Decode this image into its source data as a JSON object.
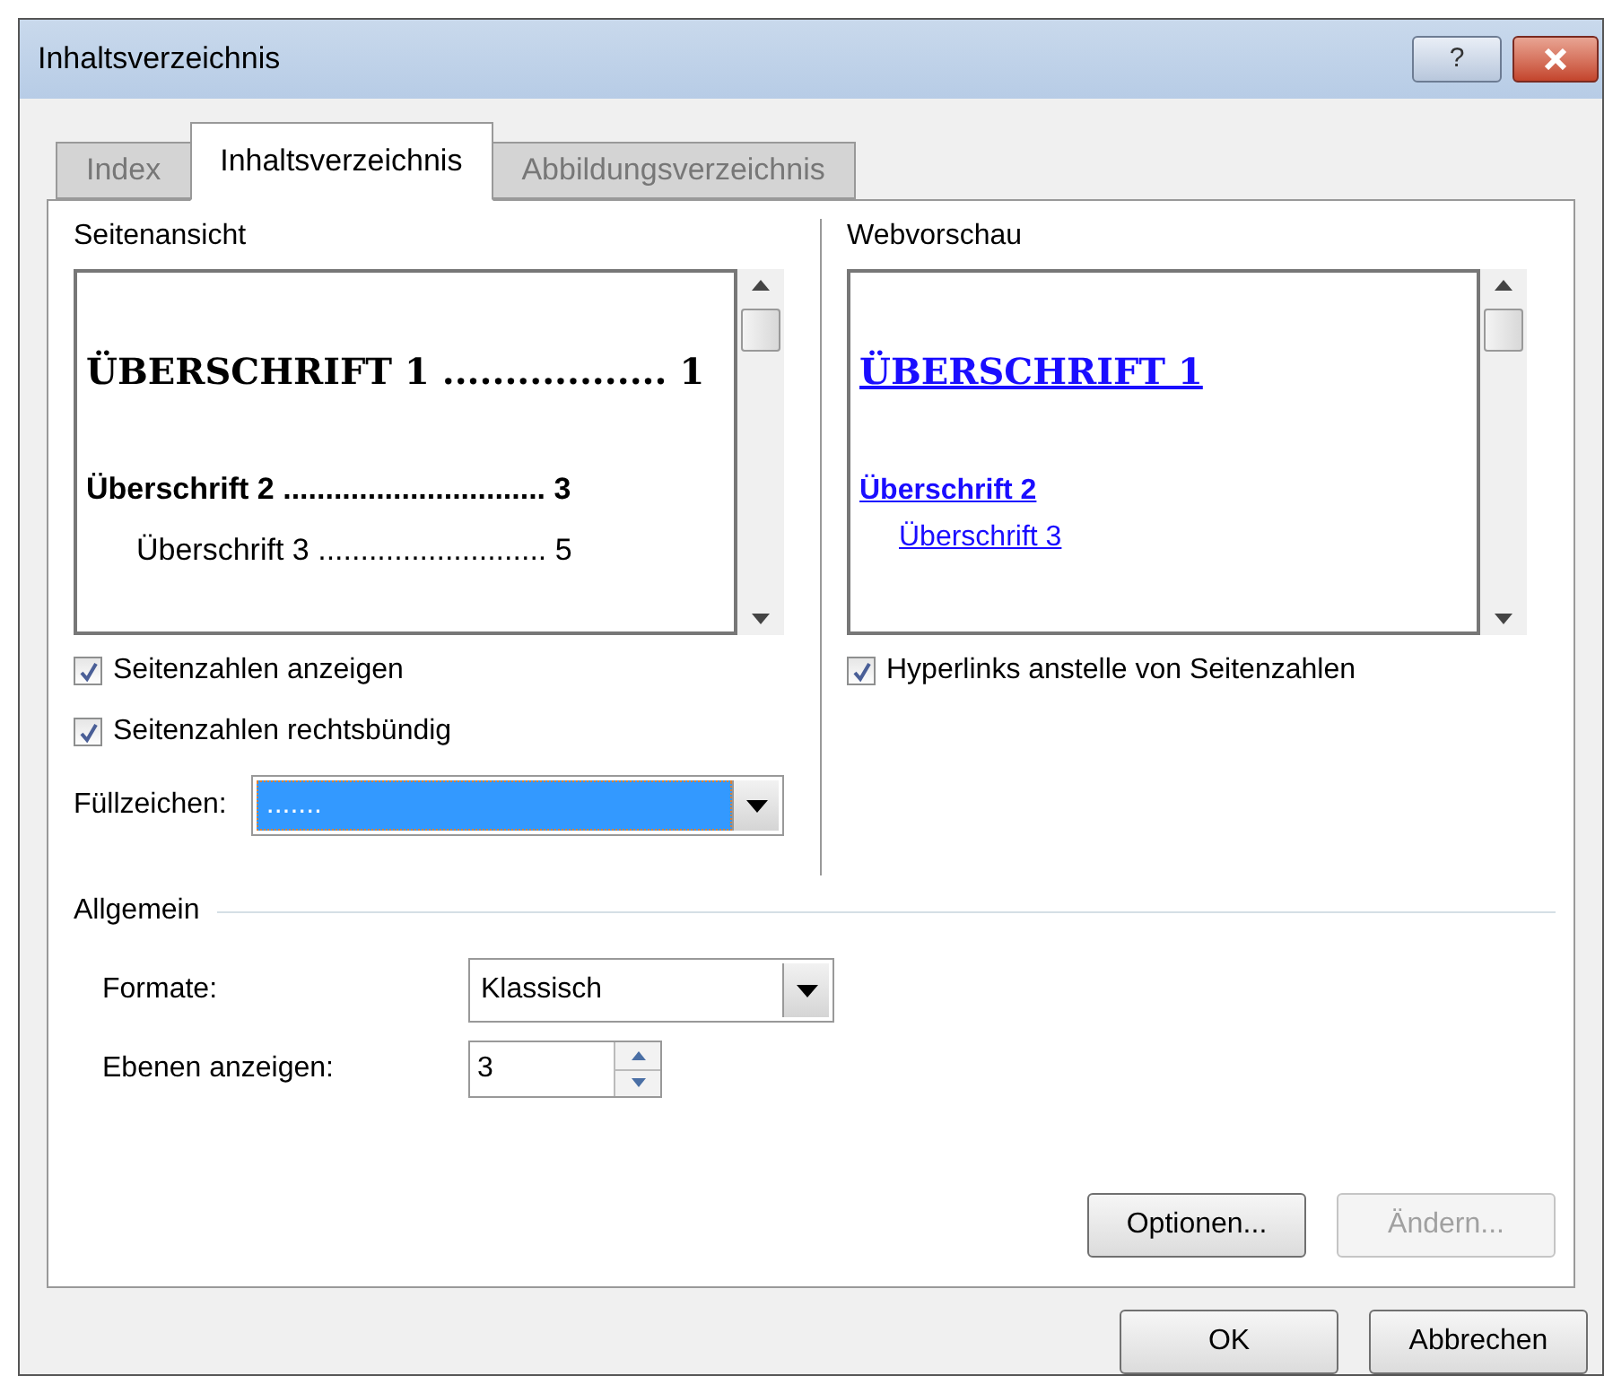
{
  "window": {
    "title": "Inhaltsverzeichnis",
    "help": "?"
  },
  "tabs": [
    {
      "label": "Index",
      "selected": false
    },
    {
      "label": "Inhaltsverzeichnis",
      "selected": true
    },
    {
      "label": "Abbildungsverzeichnis",
      "selected": false
    }
  ],
  "print_preview": {
    "label": "Seitenansicht",
    "entries": [
      {
        "kind": "heading1",
        "text": "ÜBERSCHRIFT 1",
        "leader": "..................",
        "page": "1"
      },
      {
        "kind": "heading2",
        "text": "Überschrift 2",
        "leader": "...............................",
        "page": "3"
      },
      {
        "kind": "heading3",
        "text": "Überschrift 3",
        "leader": "...........................",
        "page": "5"
      }
    ],
    "options": [
      {
        "label": "Seitenzahlen anzeigen",
        "checked": true
      },
      {
        "label": "Seitenzahlen rechtsbündig",
        "checked": true
      }
    ],
    "fill": {
      "label": "Füllzeichen:",
      "value": ".......",
      "selected": true
    }
  },
  "web_preview": {
    "label": "Webvorschau",
    "entries": [
      {
        "kind": "heading1",
        "text": "ÜBERSCHRIFT 1"
      },
      {
        "kind": "heading2",
        "text": "Überschrift 2"
      },
      {
        "kind": "heading3",
        "text": "Überschrift 3"
      }
    ],
    "options": [
      {
        "label": "Hyperlinks anstelle von Seitenzahlen",
        "checked": true
      }
    ]
  },
  "general": {
    "label": "Allgemein",
    "formats": {
      "label": "Formate:",
      "value": "Klassisch"
    },
    "levels": {
      "label": "Ebenen anzeigen:",
      "value": "3"
    }
  },
  "panel_buttons": [
    {
      "label": "Optionen...",
      "disabled": false
    },
    {
      "label": "Ändern...",
      "disabled": true
    }
  ],
  "buttons": [
    {
      "label": "OK",
      "disabled": false
    },
    {
      "label": "Abbrechen",
      "disabled": false
    }
  ]
}
